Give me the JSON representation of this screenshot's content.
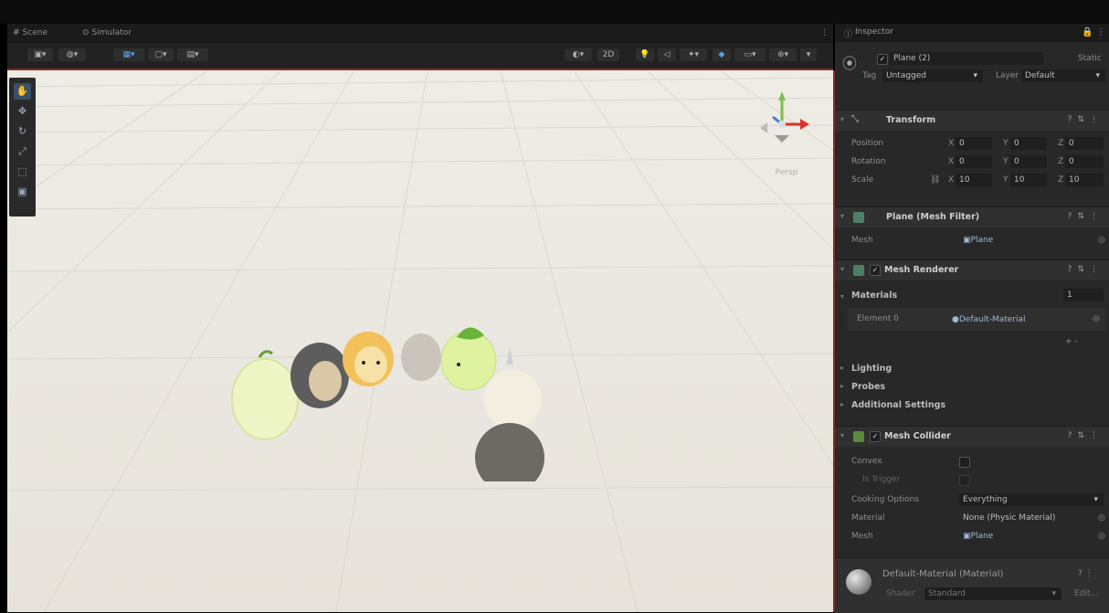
{
  "scene_tabs": [
    {
      "icon": "hash-icon",
      "label": "Scene"
    },
    {
      "icon": "simulator-icon",
      "label": "Simulator"
    }
  ],
  "scene_toolbar": {
    "left_buttons": [
      "▾",
      "▾",
      "▾",
      "▾",
      "▾"
    ],
    "right_buttons": [
      "▾",
      "2D",
      "▾",
      "▾",
      "▾",
      "▾"
    ]
  },
  "tools": [
    "view-tool",
    "move-tool",
    "rotate-tool",
    "scale-tool",
    "rect-tool",
    "transform-tool"
  ],
  "gizmo": {
    "label": "Persp"
  },
  "inspector": {
    "tab_label": "Inspector",
    "object": {
      "name": "Plane (2)",
      "static_label": "Static",
      "tag_label": "Tag",
      "tag_value": "Untagged",
      "layer_label": "Layer",
      "layer_value": "Default"
    },
    "transform": {
      "title": "Transform",
      "rows": [
        {
          "label": "Position",
          "x": "0",
          "y": "0",
          "z": "0"
        },
        {
          "label": "Rotation",
          "x": "0",
          "y": "0",
          "z": "0"
        },
        {
          "label": "Scale",
          "x": "10",
          "y": "10",
          "z": "10"
        }
      ]
    },
    "mesh_filter": {
      "title": "Plane (Mesh Filter)",
      "mesh_label": "Mesh",
      "mesh_value": "Plane"
    },
    "mesh_renderer": {
      "title": "Mesh Renderer",
      "materials_label": "Materials",
      "materials_count": "1",
      "element_label": "Element 0",
      "element_value": "Default-Material",
      "add_remove": "+ -"
    },
    "sections": [
      "Lighting",
      "Probes",
      "Additional Settings"
    ],
    "mesh_collider": {
      "title": "Mesh Collider",
      "convex_label": "Convex",
      "trigger_label": "Is Trigger",
      "cooking_label": "Cooking Options",
      "cooking_value": "Everything",
      "material_label": "Material",
      "material_value": "None (Physic Material)",
      "mesh_label": "Mesh",
      "mesh_value": "Plane"
    },
    "material_preview": {
      "title": "Default-Material (Material)",
      "shader_label": "Shader",
      "shader_value": "Standard",
      "edit_label": "Edit..."
    }
  },
  "colors": {
    "accent_red": "#8a2a22",
    "panel_bg": "#282828",
    "toolbar_blue": "#5aa0e6"
  }
}
